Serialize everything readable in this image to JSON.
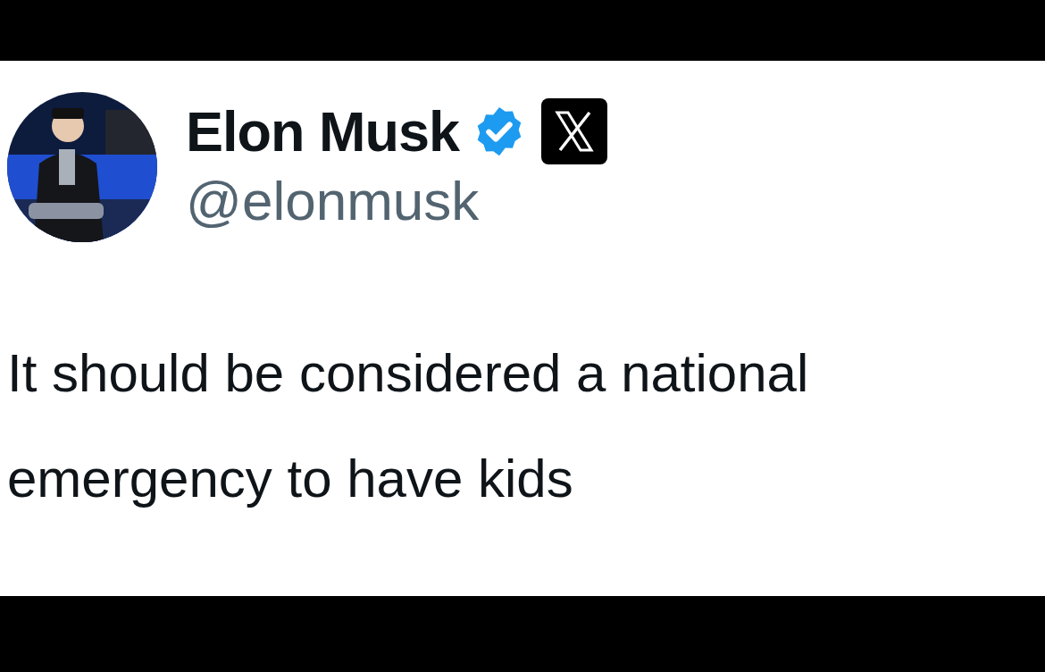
{
  "post": {
    "author": {
      "name": "Elon Musk",
      "handle": "@elonmusk",
      "verified": true
    },
    "text": "It should be considered a national emergency to have kids"
  }
}
